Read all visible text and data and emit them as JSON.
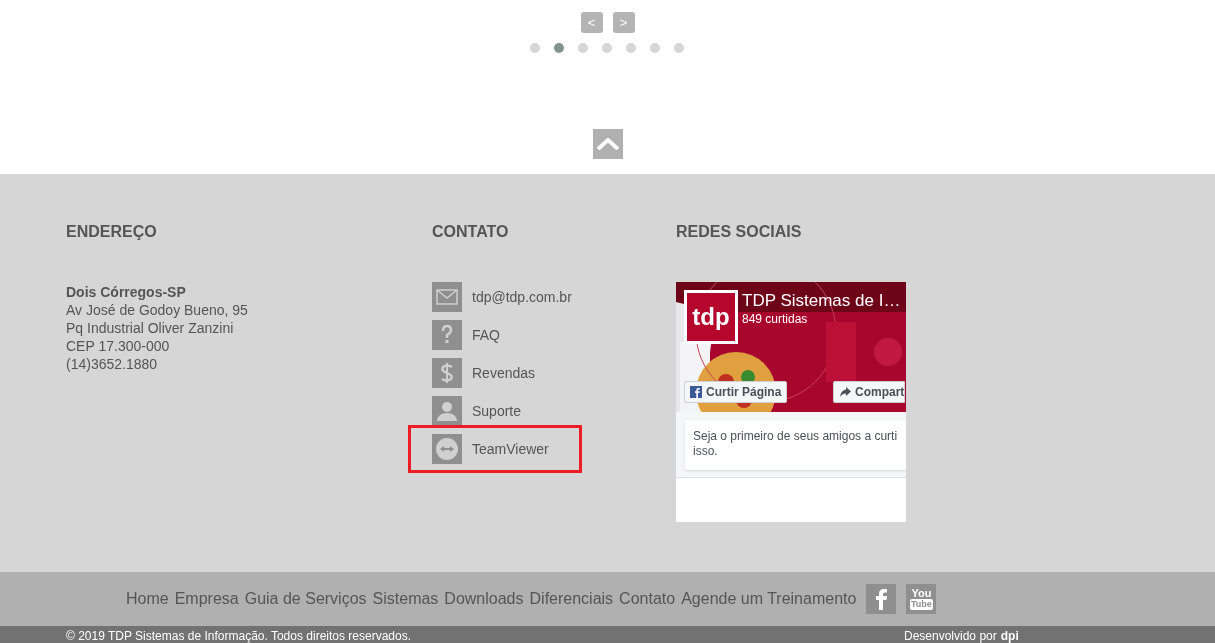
{
  "carousel": {
    "prev": "<",
    "next": ">",
    "dots": [
      {
        "selected": false
      },
      {
        "selected": true
      },
      {
        "selected": false
      },
      {
        "selected": false
      },
      {
        "selected": false
      },
      {
        "selected": false
      },
      {
        "selected": false
      }
    ]
  },
  "address": {
    "heading": "ENDEREÇO",
    "city": "Dois Córregos-SP",
    "lines": [
      "Av José de Godoy Bueno, 95",
      "Pq Industrial Oliver Zanzini",
      "CEP 17.300-000",
      "(14)3652.1880"
    ]
  },
  "contact": {
    "heading": "CONTATO",
    "items": [
      {
        "kind": "mail",
        "label": "tdp@tdp.com.br",
        "highlighted": false
      },
      {
        "kind": "faq",
        "label": "FAQ",
        "highlighted": false
      },
      {
        "kind": "dollar",
        "label": "Revendas",
        "highlighted": false
      },
      {
        "kind": "person",
        "label": "Suporte",
        "highlighted": false
      },
      {
        "kind": "teamviewer",
        "label": "TeamViewer",
        "highlighted": true
      }
    ]
  },
  "social": {
    "heading": "REDES SOCIAIS",
    "page_widget": {
      "logo": "tdp",
      "page_name": "TDP Sistemas de I…",
      "likes": "849 curtidas",
      "like_button": "Curtir Página",
      "share_button": "Compart",
      "friends_text": "Seja o primeiro de seus amigos a curti isso."
    }
  },
  "nav": {
    "links": [
      "Home",
      "Empresa",
      "Guia de Serviços",
      "Sistemas",
      "Downloads",
      "Diferenciais",
      "Contato",
      "Agende um Treinamento"
    ],
    "social_icons": [
      {
        "kind": "facebook"
      },
      {
        "kind": "youtube",
        "text": "You Tube"
      }
    ]
  },
  "bottom_bar": {
    "copyright": "© 2019 TDP Sistemas de Informação. Todos direitos reservados.",
    "credit": "Desenvolvido por",
    "credit_logo": "dpi"
  }
}
